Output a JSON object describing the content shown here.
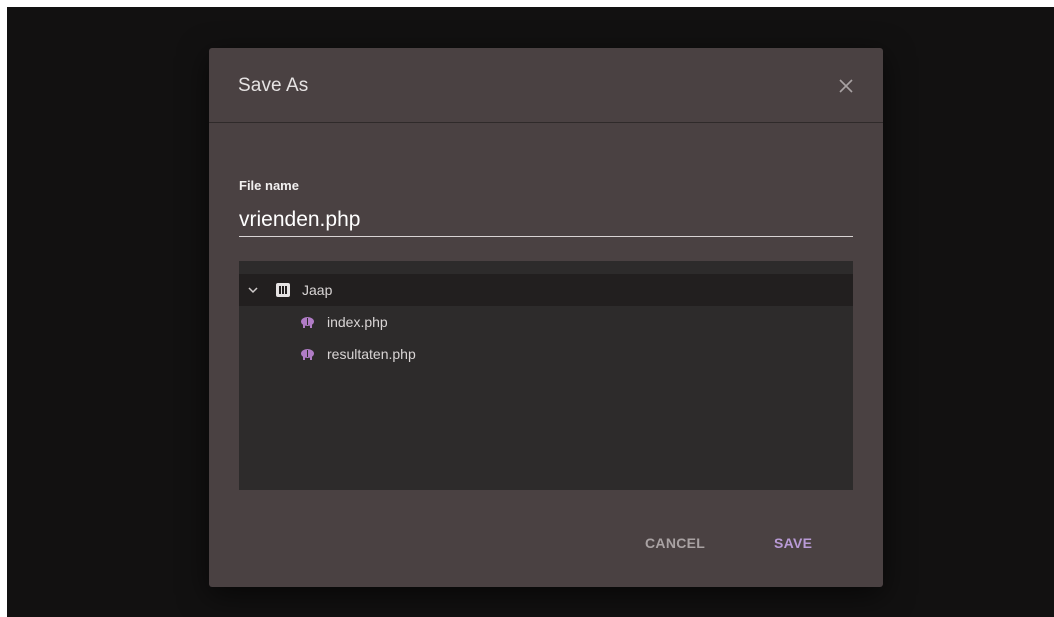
{
  "dialog": {
    "title": "Save As",
    "close_icon": "close-icon"
  },
  "form": {
    "file_name_label": "File name",
    "file_name_value": "vrienden.php"
  },
  "tree": {
    "folder": {
      "name": "Jaap",
      "expanded": true,
      "icon": "folder-icon"
    },
    "files": [
      {
        "name": "index.php",
        "icon": "php-elephant-icon"
      },
      {
        "name": "resultaten.php",
        "icon": "php-elephant-icon"
      }
    ]
  },
  "actions": {
    "cancel_label": "CANCEL",
    "save_label": "SAVE"
  },
  "colors": {
    "backdrop": "#121111",
    "dialog_bg": "#4a4142",
    "tree_bg": "#2d2b2b",
    "accent": "#b99ad6",
    "php_icon": "#b07cc6"
  }
}
